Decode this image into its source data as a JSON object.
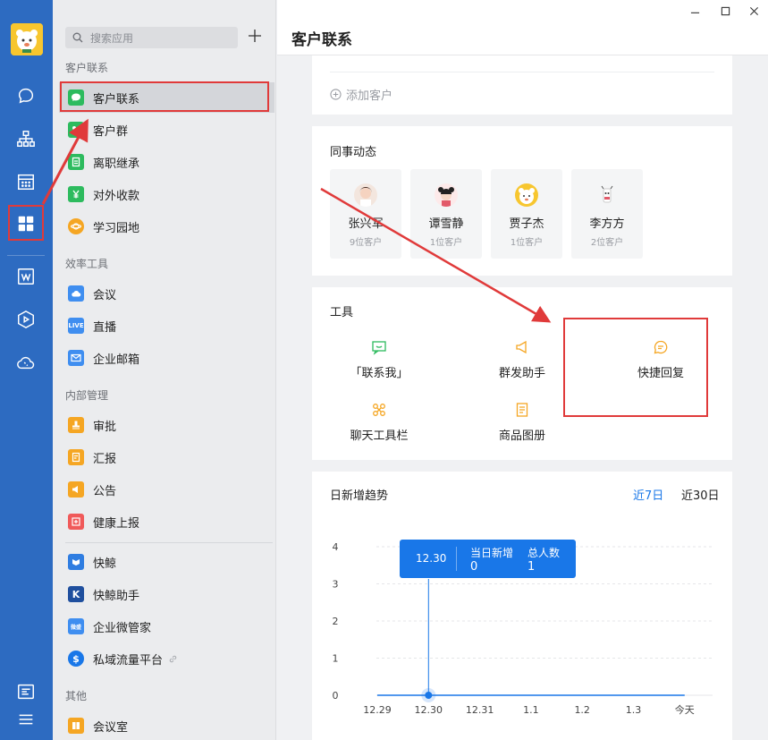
{
  "app": {
    "title": "客户联系",
    "accent": "#2d6bc1"
  },
  "rail": {
    "items": [
      {
        "icon": "chat-bubble-icon"
      },
      {
        "icon": "org-chart-icon"
      },
      {
        "icon": "calendar-icon"
      },
      {
        "icon": "workbench-grid-icon"
      },
      {
        "icon": "doc-icon"
      },
      {
        "icon": "cube-icon"
      },
      {
        "icon": "phone-cloud-icon"
      },
      {
        "icon": "settings-sliders-icon"
      },
      {
        "icon": "menu-icon"
      }
    ]
  },
  "sidebar": {
    "search_placeholder": "搜索应用",
    "sections": [
      {
        "title": "客户联系",
        "items": [
          {
            "label": "客户联系",
            "color": "#2dbb5e"
          },
          {
            "label": "客户群",
            "color": "#2dbb5e"
          },
          {
            "label": "离职继承",
            "color": "#2dbb5e"
          },
          {
            "label": "对外收款",
            "color": "#2dbb5e"
          },
          {
            "label": "学习园地",
            "color": "#f5a623"
          }
        ]
      },
      {
        "title": "效率工具",
        "items": [
          {
            "label": "会议",
            "color": "#3f8ef0"
          },
          {
            "label": "直播",
            "color": "#3f8ef0",
            "badge": "LIVE"
          },
          {
            "label": "企业邮箱",
            "color": "#3f8ef0"
          }
        ]
      },
      {
        "title": "内部管理",
        "items": [
          {
            "label": "审批",
            "color": "#f5a623"
          },
          {
            "label": "汇报",
            "color": "#f5a623"
          },
          {
            "label": "公告",
            "color": "#f5a623"
          },
          {
            "label": "健康上报",
            "color": "#f05a5a"
          }
        ]
      },
      {
        "title": "",
        "items": [
          {
            "label": "快鲸",
            "color": "#2f7de1"
          },
          {
            "label": "快鲸助手",
            "color": "#1f4f9e"
          },
          {
            "label": "企业微管家",
            "color": "#3f8ef0",
            "badge": "微盛"
          },
          {
            "label": "私域流量平台",
            "color": "#1977e8"
          }
        ]
      },
      {
        "title": "其他",
        "items": [
          {
            "label": "会议室",
            "color": "#f5a623"
          }
        ]
      }
    ]
  },
  "customers_card": {
    "add_label": "添加客户"
  },
  "colleagues": {
    "title": "同事动态",
    "items": [
      {
        "name": "张兴军",
        "count": "9位客户"
      },
      {
        "name": "谭雪静",
        "count": "1位客户"
      },
      {
        "name": "贾子杰",
        "count": "1位客户"
      },
      {
        "name": "李方方",
        "count": "2位客户"
      }
    ]
  },
  "tools": {
    "title": "工具",
    "items": [
      {
        "label": "「联系我」",
        "icon": "contact-me-icon",
        "color": "#2dbb5e"
      },
      {
        "label": "群发助手",
        "icon": "megaphone-icon",
        "color": "#f5a623"
      },
      {
        "label": "快捷回复",
        "icon": "quick-reply-icon",
        "color": "#f5a623"
      },
      {
        "label": "聊天工具栏",
        "icon": "toolbar-icon",
        "color": "#f5a623"
      },
      {
        "label": "商品图册",
        "icon": "catalog-icon",
        "color": "#f5a623"
      }
    ]
  },
  "trend": {
    "title": "日新增趋势",
    "range_options": [
      "近7日",
      "近30日"
    ],
    "selected_range": "近7日",
    "tooltip": {
      "date": "12.30",
      "col1_label": "当日新增",
      "col1_value": "0",
      "col2_label": "总人数",
      "col2_value": "1"
    }
  },
  "chart_data": {
    "type": "line",
    "categories": [
      "12.29",
      "12.30",
      "12.31",
      "1.1",
      "1.2",
      "1.3",
      "今天"
    ],
    "series": [
      {
        "values": [
          0,
          0,
          0,
          0,
          0,
          0,
          0
        ]
      }
    ],
    "y_ticks": [
      0,
      1,
      2,
      3,
      4
    ],
    "ylim": [
      0,
      4
    ],
    "grid": true,
    "highlight_category": "12.30",
    "color": "#1977e8"
  }
}
